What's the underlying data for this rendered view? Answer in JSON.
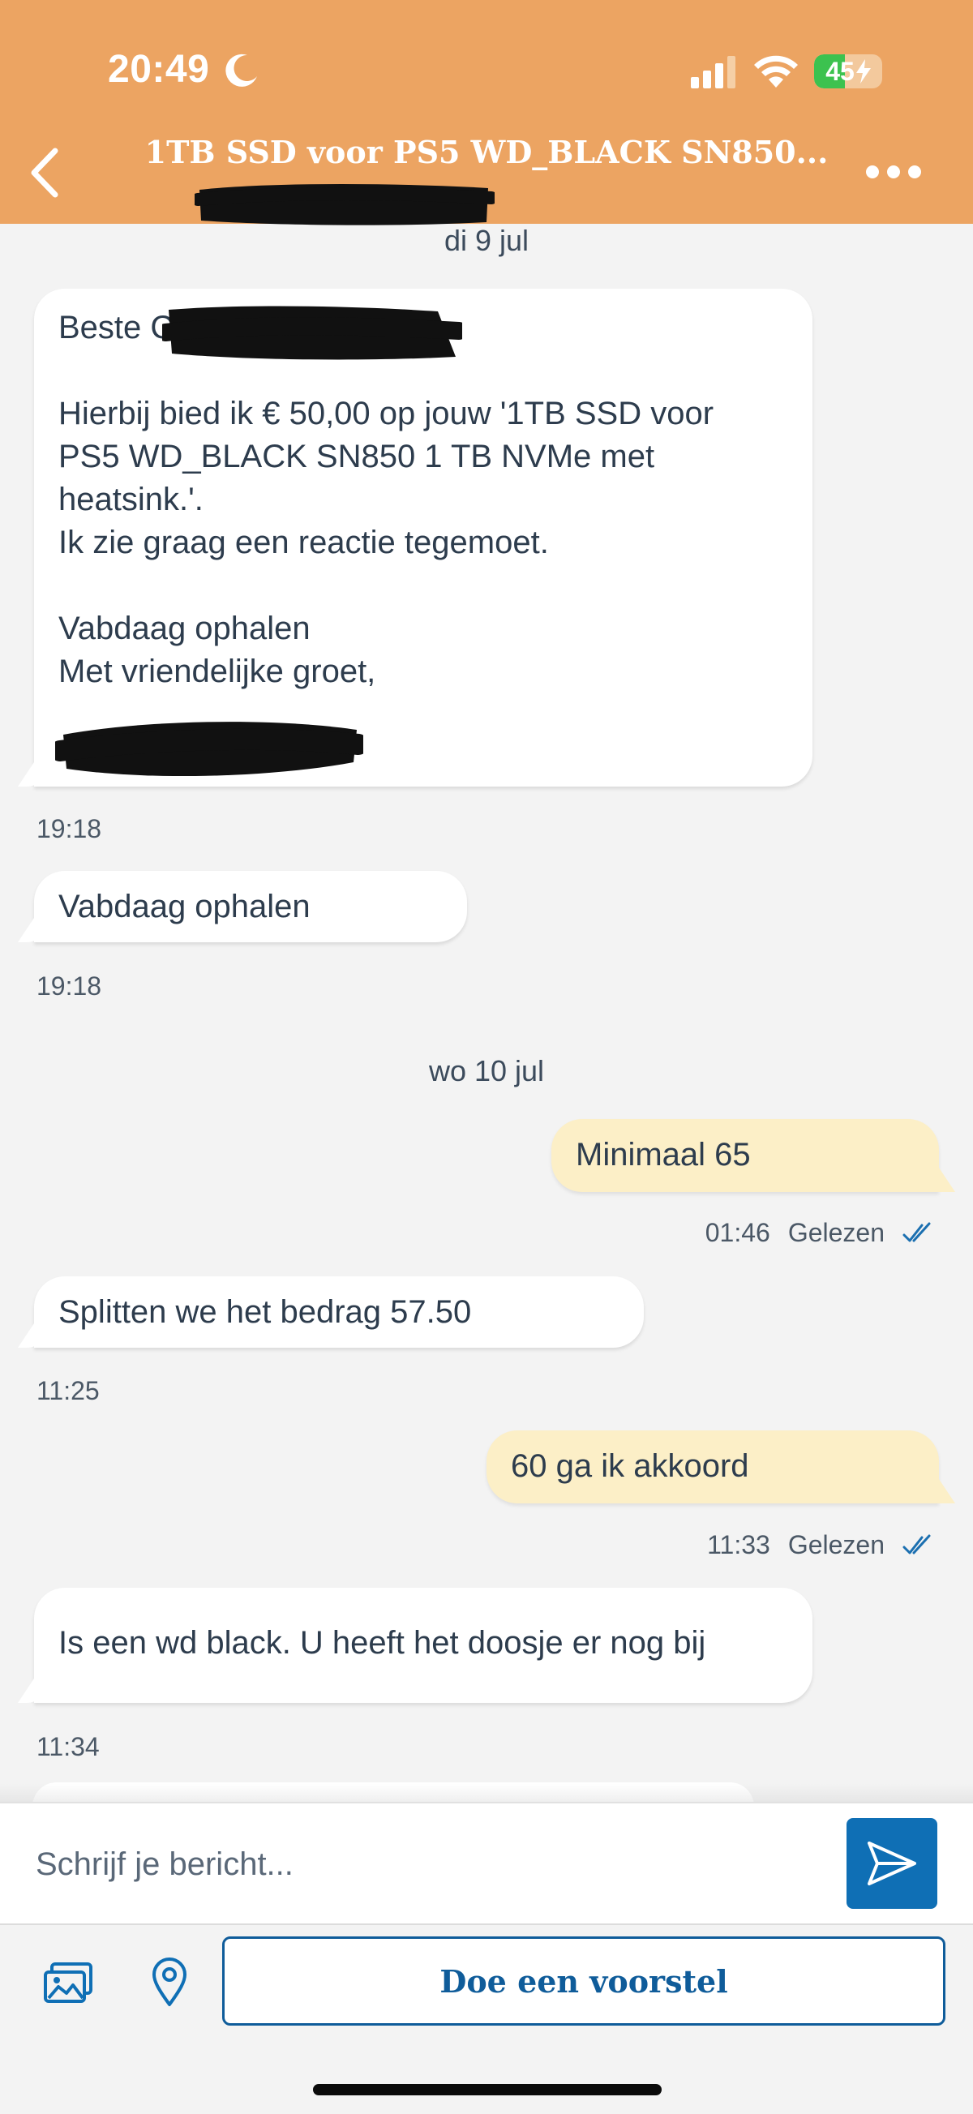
{
  "status_bar": {
    "time": "20:49",
    "battery_percent": "45",
    "battery_level": 0.45,
    "icons": [
      "moon-icon",
      "cellular-signal-icon",
      "wifi-icon",
      "battery-charging-icon"
    ]
  },
  "header": {
    "title": "1TB SSD voor PS5 WD_BLACK SN850...",
    "back_icon": "chevron-left-icon",
    "more_icon": "more-dots-icon",
    "background_color": "#eca462"
  },
  "conversation": {
    "days": [
      {
        "label": "di 9 jul",
        "messages": [
          {
            "direction": "incoming",
            "lines": [
              "Beste C",
              "",
              "Hierbij bied ik € 50,00 op jouw '1TB SSD voor",
              "PS5 WD_BLACK SN850 1 TB NVMe met",
              "heatsink.'.",
              "Ik zie graag een reactie tegemoet.",
              "",
              "Vabdaag ophalen",
              "Met vriendelijke groet,",
              ""
            ],
            "time": "19:18"
          },
          {
            "direction": "incoming",
            "lines": [
              "Vabdaag ophalen"
            ],
            "time": "19:18"
          }
        ]
      },
      {
        "label": "wo 10 jul",
        "messages": [
          {
            "direction": "outgoing",
            "lines": [
              "Minimaal 65"
            ],
            "time": "01:46",
            "status": "Gelezen"
          },
          {
            "direction": "incoming",
            "lines": [
              "Splitten we het bedrag 57.50"
            ],
            "time": "11:25"
          },
          {
            "direction": "outgoing",
            "lines": [
              "60 ga ik akkoord"
            ],
            "time": "11:33",
            "status": "Gelezen"
          },
          {
            "direction": "incoming",
            "lines": [
              "Is een wd black. U heeft het doosje er nog bij"
            ],
            "time": "11:34"
          }
        ]
      }
    ]
  },
  "composer": {
    "placeholder": "Schrijf je bericht...",
    "value": "",
    "send_icon": "send-icon"
  },
  "actions": {
    "photo_icon": "photo-gallery-icon",
    "location_icon": "location-pin-icon",
    "offer_label": "Doe een voorstel"
  },
  "colors": {
    "accent": "#0f6fb5",
    "outgoing_bubble": "#fcefc7",
    "incoming_bubble": "#ffffff",
    "read_check": "#1b6fb0"
  }
}
